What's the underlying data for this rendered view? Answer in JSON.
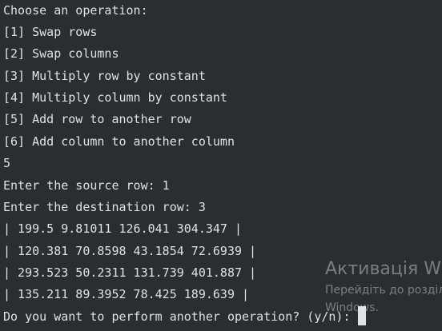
{
  "terminal": {
    "lines": [
      "Choose an operation:",
      "[1] Swap rows",
      "[2] Swap columns",
      "[3] Multiply row by constant",
      "[4] Multiply column by constant",
      "[5] Add row to another row",
      "[6] Add column to another column",
      "5",
      "Enter the source row: 1",
      "Enter the destination row: 3",
      "| 199.5 9.81011 126.041 304.347 |",
      "| 120.381 70.8598 43.1854 72.6939 |",
      "| 293.523 50.2311 131.739 401.887 |",
      "| 135.211 89.3952 78.425 189.639 |",
      "Do you want to perform another operation? (y/n): "
    ]
  },
  "watermark": {
    "title": "Активація Windows",
    "line1": "Перейдіть до розділу",
    "line2": "Windows."
  },
  "colors": {
    "background": "#2b2d30",
    "text": "#dfe1e5"
  }
}
